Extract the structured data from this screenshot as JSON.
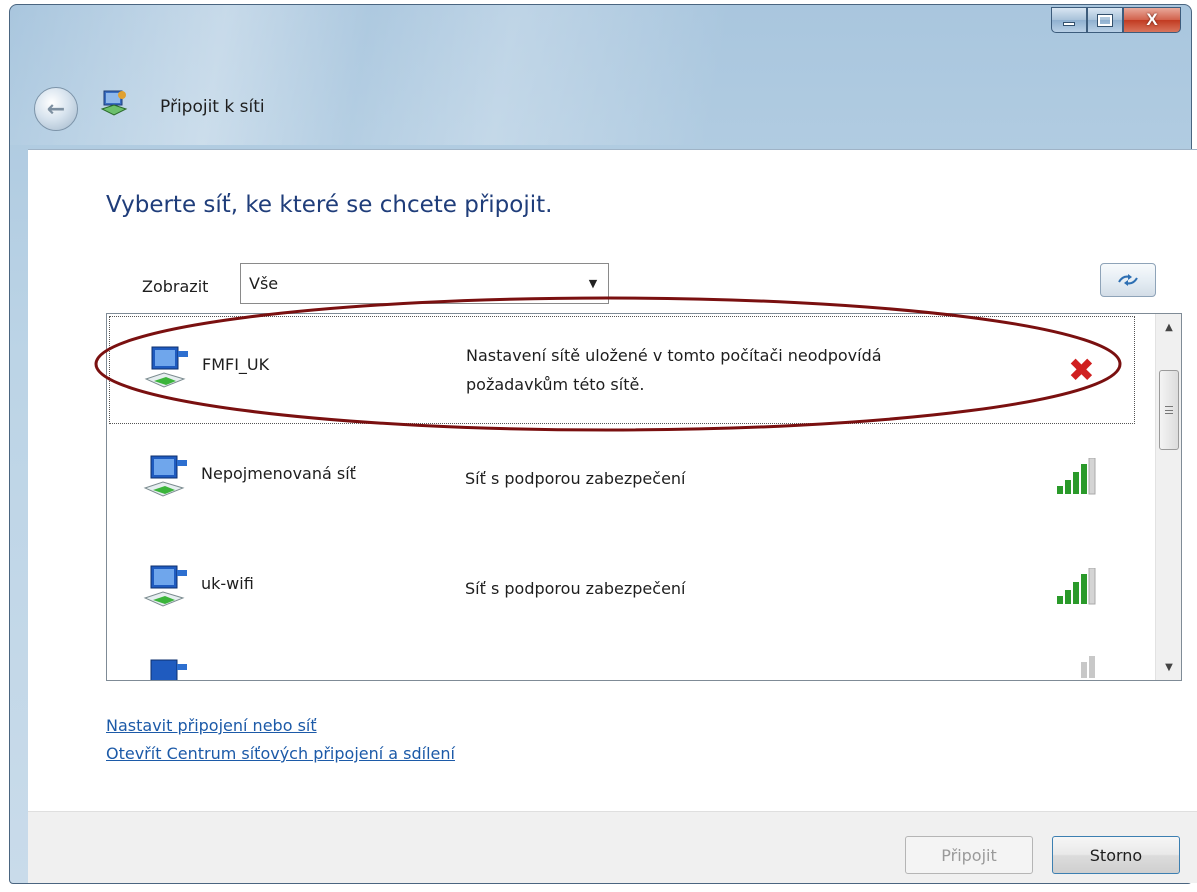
{
  "window": {
    "title": "Připojit k síti",
    "caption": {
      "minimize_icon": "minimize-icon",
      "maximize_icon": "maximize-icon",
      "close_glyph": "X"
    }
  },
  "main": {
    "heading": "Vyberte síť, ke které se chcete připojit.",
    "filter": {
      "label": "Zobrazit",
      "selected": "Vše"
    },
    "networks": [
      {
        "name": "FMFI_UK",
        "status_line1": "Nastavení sítě uložené v tomto počítači neodpovídá",
        "status_line2": "požadavkům této sítě.",
        "indicator": "error-x",
        "highlighted": true
      },
      {
        "name": "Nepojmenovaná síť",
        "status_line1": "Síť s podporou zabezpečení",
        "indicator": "signal-strong",
        "signal_level": 4
      },
      {
        "name": "uk-wifi",
        "status_line1": "Síť s podporou zabezpečení",
        "indicator": "signal-strong",
        "signal_level": 4
      },
      {
        "name": "",
        "status_line1": "",
        "indicator": "signal-weak",
        "signal_level": 1
      }
    ],
    "links": {
      "setup": "Nastavit připojení nebo síť",
      "center": "Otevřít Centrum síťových připojení a sdílení"
    }
  },
  "footer": {
    "connect_label": "Připojit",
    "cancel_label": "Storno"
  },
  "colors": {
    "heading": "#1f3d7a",
    "link": "#1c5aa8",
    "annotation": "#7a1010",
    "error": "#d02020",
    "signal": "#2a9a2a"
  }
}
